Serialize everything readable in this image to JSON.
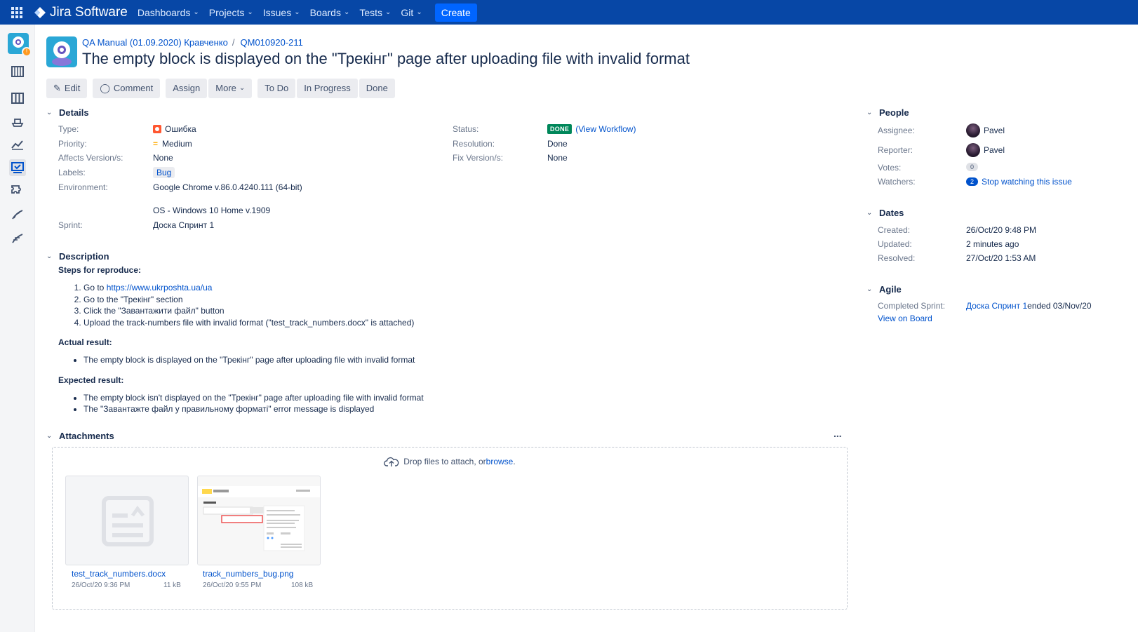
{
  "topbar": {
    "product": "Jira Software",
    "nav": [
      "Dashboards",
      "Projects",
      "Issues",
      "Boards",
      "Tests",
      "Git"
    ],
    "create": "Create"
  },
  "breadcrumb": {
    "project": "QA Manual (01.09.2020) Кравченко",
    "separator": "/",
    "issue_key": "QM010920-211"
  },
  "issue": {
    "summary": "The empty block is displayed on the \"Трекінг\" page after uploading file with invalid format"
  },
  "toolbar": {
    "edit": "Edit",
    "comment": "Comment",
    "assign": "Assign",
    "more": "More",
    "todo": "To Do",
    "inprogress": "In Progress",
    "done": "Done"
  },
  "details": {
    "header": "Details",
    "type_label": "Type:",
    "type_value": "Ошибка",
    "priority_label": "Priority:",
    "priority_value": "Medium",
    "affects_label": "Affects Version/s:",
    "affects_value": "None",
    "labels_label": "Labels:",
    "labels_value": "Bug",
    "env_label": "Environment:",
    "env_value_1": "Google Chrome v.86.0.4240.111 (64-bit)",
    "env_value_2": "OS - Windows 10 Home v.1909",
    "sprint_label": "Sprint:",
    "sprint_value": "Доска Спринт 1",
    "status_label": "Status:",
    "status_value": "DONE",
    "workflow_link": "(View Workflow)",
    "resolution_label": "Resolution:",
    "resolution_value": "Done",
    "fix_label": "Fix Version/s:",
    "fix_value": "None"
  },
  "description": {
    "header": "Description",
    "steps_title": "Steps for reproduce:",
    "step1_prefix": "Go to ",
    "step1_link": "https://www.ukrposhta.ua/ua",
    "step2": "Go to the \"Трекінг\" section",
    "step3": "Click the \"Завантажити файл\" button",
    "step4": "Upload the track-numbers file with invalid format (\"test_track_numbers.docx\" is attached)",
    "actual_title": "Actual result:",
    "actual1": "The empty block is displayed on the \"Трекінг\" page after uploading file with invalid format",
    "expected_title": "Expected result:",
    "expected1": "The empty block isn't displayed on the \"Трекінг\" page after uploading file with invalid format",
    "expected2": "The \"Завантажте файл у правильному форматі\" error message is displayed"
  },
  "attachments": {
    "header": "Attachments",
    "more": "...",
    "drop_text": "Drop files to attach, or ",
    "browse": "browse",
    "drop_end": ".",
    "files": [
      {
        "name": "test_track_numbers.docx",
        "date": "26/Oct/20 9:36 PM",
        "size": "11 kB"
      },
      {
        "name": "track_numbers_bug.png",
        "date": "26/Oct/20 9:55 PM",
        "size": "108 kB"
      }
    ]
  },
  "people": {
    "header": "People",
    "assignee_label": "Assignee:",
    "assignee": "Pavel",
    "reporter_label": "Reporter:",
    "reporter": "Pavel",
    "votes_label": "Votes:",
    "votes": "0",
    "watchers_label": "Watchers:",
    "watchers": "2",
    "watch_link": "Stop watching this issue"
  },
  "dates": {
    "header": "Dates",
    "created_label": "Created:",
    "created": "26/Oct/20 9:48 PM",
    "updated_label": "Updated:",
    "updated": "2 minutes ago",
    "resolved_label": "Resolved:",
    "resolved": "27/Oct/20 1:53 AM"
  },
  "agile": {
    "header": "Agile",
    "completed_label": "Completed Sprint:",
    "sprint_link": "Доска Спринт 1",
    "sprint_end": " ended 03/Nov/20",
    "board_link": "View on Board"
  },
  "colors": {
    "topbar": "#0747a6",
    "create": "#0065ff",
    "link": "#0052cc",
    "done": "#00875a"
  }
}
